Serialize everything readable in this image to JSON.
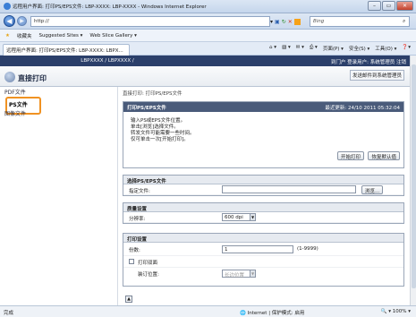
{
  "window": {
    "title": "远程用户界面: 打印PS/EPS文件: LBP-XXXX: LBP-XXXX - Windows Internet Explorer"
  },
  "browser": {
    "address": "http://",
    "search_placeholder": "Bing",
    "favorites_label": "收藏夹",
    "fav_items": [
      "Suggested Sites ▾",
      "Web Slice Gallery ▾"
    ],
    "tab_title": "远程用户界面: 打印PS/EPS文件: LBP-XXXX: LBPX...",
    "tab_tools": [
      "页面(P) ▾",
      "安全(S) ▾",
      "工具(O) ▾"
    ]
  },
  "app": {
    "header_center": "LBPXXXX / LBPXXXX /",
    "header_right": "到门户  登录用户: 系统管理员 注销",
    "page_title": "直接打印",
    "send_link": "发送邮件到系统管理员"
  },
  "sidebar": {
    "items": [
      {
        "label": "PDF文件",
        "selected": false
      },
      {
        "label": "PS文件",
        "selected": true
      },
      {
        "label": "图像文件",
        "selected": false
      }
    ]
  },
  "main": {
    "breadcrumb": "直接打印: 打印PS/EPS文件",
    "panel_title": "打印PS/EPS文件",
    "last_updated": "最近更新: 24/10 2011 05:32:04",
    "instructions": [
      "输入PS或EPS文件位置。",
      "单击[浏览]选择文件。",
      "转发文件可能需要一些时间。",
      "仅可单击一次[开始打印]。"
    ],
    "start_btn": "开始打印",
    "reset_btn": "恢复默认值",
    "section_select": "选择PS/EPS文件",
    "file_label": "指定文件:",
    "browse_btn": "浏览...",
    "section_quality": "质量设置",
    "resolution_label": "分辨率:",
    "resolution_value": "600 dpi",
    "section_print": "打印设置",
    "copies_label": "份数:",
    "copies_value": "1",
    "copies_range": "(1-9999)",
    "duplex_label": "打印双面",
    "binding_label": "装订位置:",
    "binding_value": "长边位置"
  },
  "status": {
    "left": "完成",
    "zone": "Internet | 保护模式: 启用",
    "zoom": "100%"
  }
}
